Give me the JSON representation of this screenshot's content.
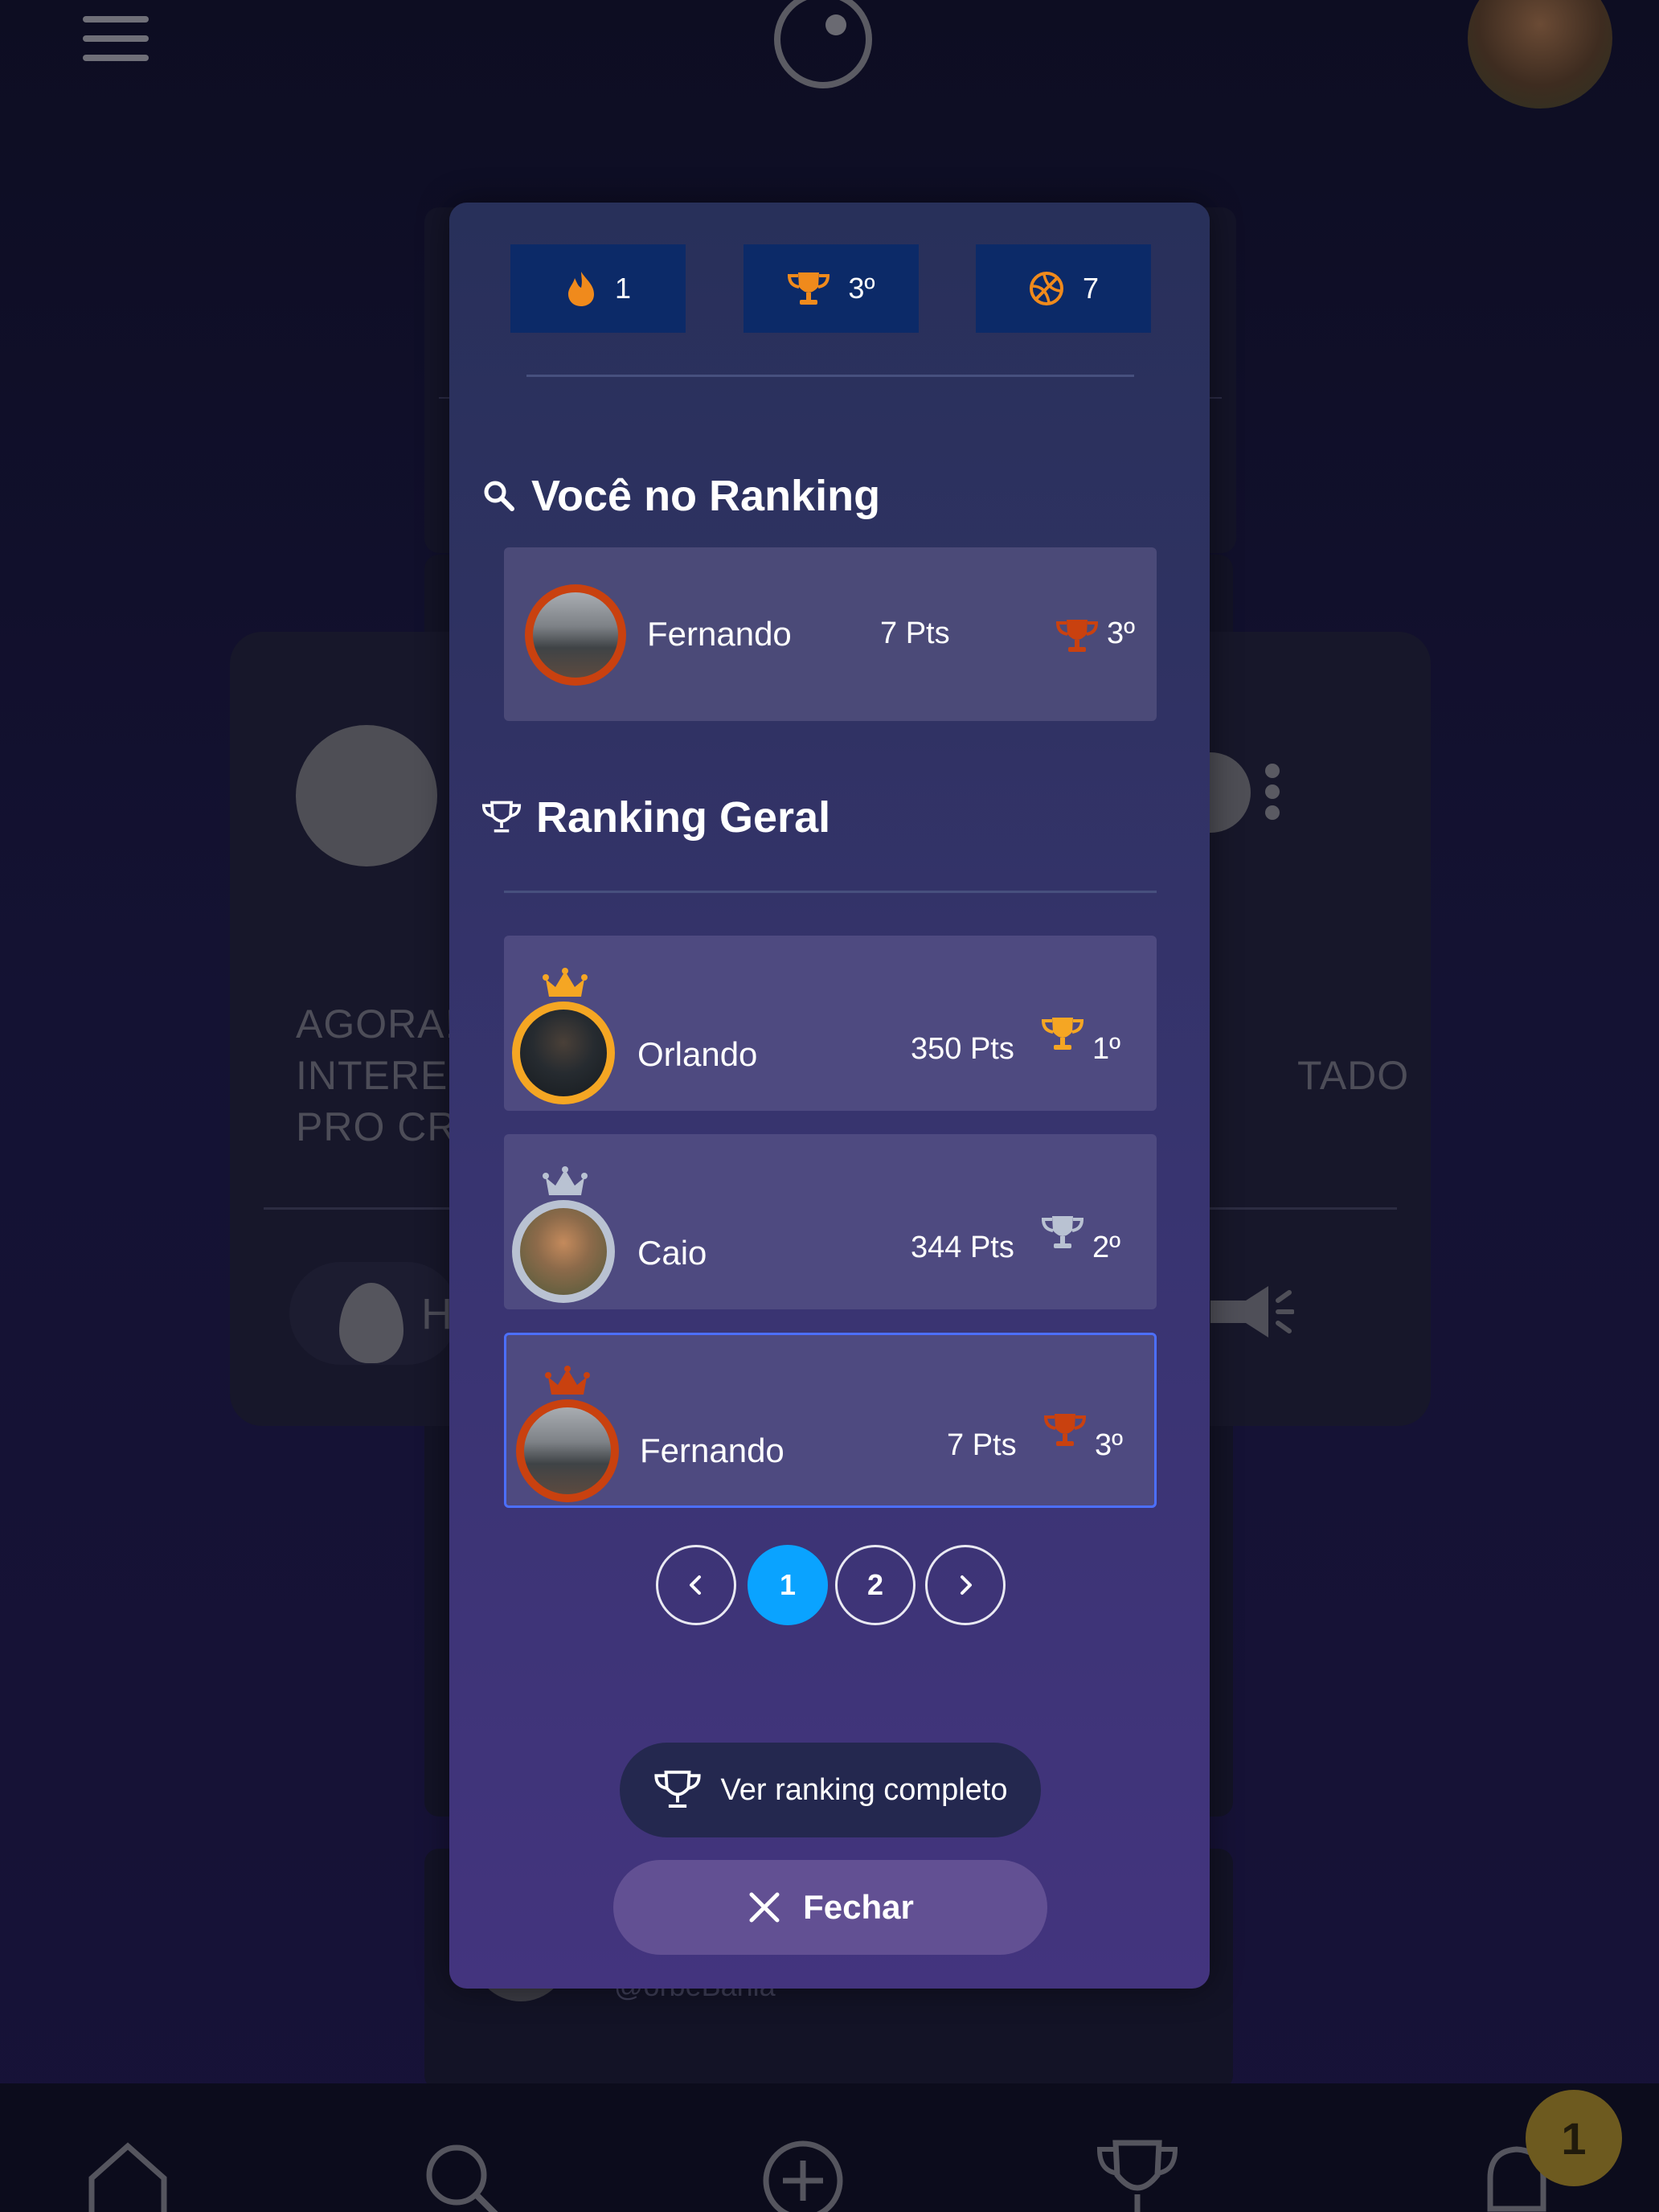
{
  "app": {
    "background_post_text": [
      "AGORA!",
      "INTERE",
      "PRO CR"
    ],
    "background_post_text_right": "TADO",
    "background_react_letter": "H",
    "background_handle": "@orbeBahia",
    "notification_badge": "1"
  },
  "stats": {
    "streak": "1",
    "rank": "3º",
    "score": "7"
  },
  "you_section": {
    "title": "Você no Ranking",
    "user": {
      "name": "Fernando",
      "points": "7 Pts",
      "place": "3º"
    }
  },
  "general_section": {
    "title": "Ranking Geral",
    "rows": [
      {
        "name": "Orlando",
        "points": "350 Pts",
        "place": "1º"
      },
      {
        "name": "Caio",
        "points": "344 Pts",
        "place": "2º"
      },
      {
        "name": "Fernando",
        "points": "7 Pts",
        "place": "3º"
      }
    ]
  },
  "pagination": {
    "prev": "‹",
    "pages": [
      "1",
      "2"
    ],
    "current": "1",
    "next": "›"
  },
  "buttons": {
    "full_ranking": "Ver ranking completo",
    "close": "Fechar"
  },
  "colors": {
    "gold": "#f5a623",
    "silver": "#b9c2d2",
    "bronze": "#c9410f",
    "accent": "#0aa3ff",
    "stat_bg": "#0c2a68"
  },
  "icons": [
    "menu-icon",
    "logo-icon",
    "flame-icon",
    "trophy-icon",
    "basketball-icon",
    "search-icon",
    "crown-icon",
    "chevron-left-icon",
    "chevron-right-icon",
    "close-icon",
    "home-icon",
    "plus-icon",
    "bell-icon"
  ]
}
